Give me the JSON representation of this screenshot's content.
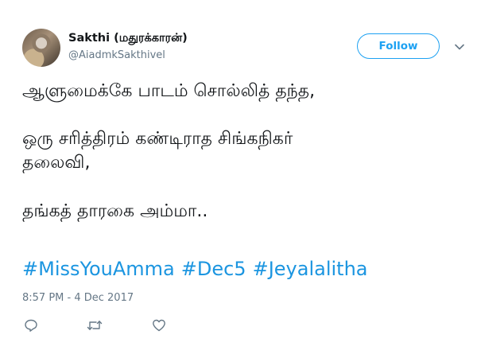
{
  "user": {
    "display_name": "Sakthi (மதுரக்காரன்)",
    "handle": "@AiadmkSakthivel"
  },
  "header": {
    "follow_label": "Follow"
  },
  "tweet": {
    "lines": [
      "ஆளுமைக்கே பாடம் சொல்லித் தந்த,",
      "ஒரு சரித்திரம் கண்டிராத சிங்கநிகர்",
      "தலைவி,",
      "தங்கத் தாரகை அம்மா.."
    ],
    "hashtags": [
      "#MissYouAmma",
      "#Dec5",
      "#Jeyalalitha"
    ],
    "timestamp": "8:57 PM - 4 Dec 2017"
  },
  "icons": {
    "caret": "chevron-down-icon",
    "reply": "reply-icon",
    "retweet": "retweet-icon",
    "like": "heart-icon"
  },
  "colors": {
    "accent": "#1da1f2",
    "hashtag": "#1b95e0",
    "muted": "#657786",
    "text": "#14171a"
  }
}
